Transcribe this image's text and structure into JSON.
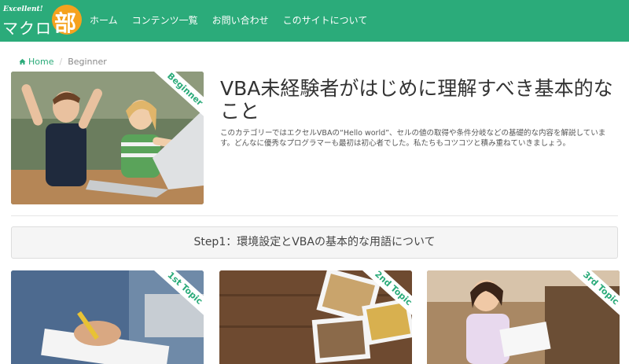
{
  "header": {
    "logo_excellent": "Excellent!",
    "logo_text": "マクロ",
    "logo_bu": "部",
    "nav": [
      {
        "label": "ホーム"
      },
      {
        "label": "コンテンツ一覧"
      },
      {
        "label": "お問い合わせ"
      },
      {
        "label": "このサイトについて"
      }
    ]
  },
  "breadcrumb": {
    "home_icon": "home-icon",
    "home": "Home",
    "separator": "/",
    "current": "Beginner"
  },
  "hero": {
    "ribbon": "Beginner",
    "title": "VBA未経験者がはじめに理解すべき基本的なこと",
    "description": "このカテゴリーではエクセルVBAの“Hello world”、セルの値の取得や条件分岐などの基礎的な内容を解説しています。どんなに優秀なプログラマーも最初は初心者でした。私たちもコツコツと積み重ねていきましょう。"
  },
  "step": {
    "title": "Step1：環境設定とVBAの基本的な用語について"
  },
  "topics": [
    {
      "ribbon": "1st Topic"
    },
    {
      "ribbon": "2nd Topic"
    },
    {
      "ribbon": "3rd Topic"
    }
  ],
  "colors": {
    "brand": "#2bab7a",
    "logo_accent": "#f5a21e"
  }
}
